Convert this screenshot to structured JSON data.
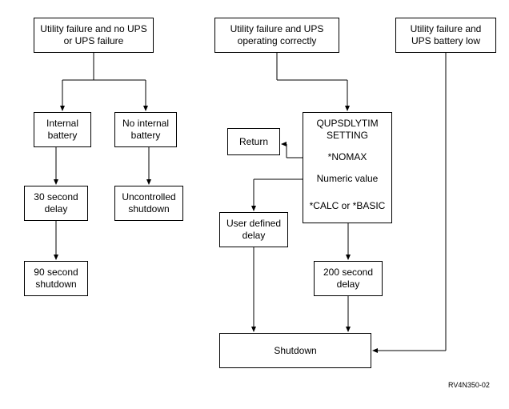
{
  "chart_data": {
    "type": "flowchart",
    "nodes": [
      {
        "id": "a1",
        "label": "Utility failure and\nno UPS or UPS failure"
      },
      {
        "id": "a2",
        "label": "Internal\nbattery"
      },
      {
        "id": "a3",
        "label": "No internal\nbattery"
      },
      {
        "id": "a4",
        "label": "30 second\ndelay"
      },
      {
        "id": "a5",
        "label": "Uncontrolled\nshutdown"
      },
      {
        "id": "a6",
        "label": "90 second\nshutdown"
      },
      {
        "id": "b1",
        "label": "Utility failure and UPS\noperating correctly"
      },
      {
        "id": "b2",
        "label": "Return"
      },
      {
        "id": "b3a",
        "label": "QUPSDLYTIM\nSETTING"
      },
      {
        "id": "b3b",
        "label": "*NOMAX"
      },
      {
        "id": "b3c",
        "label": "Numeric value"
      },
      {
        "id": "b3d",
        "label": "*CALC or\n*BASIC"
      },
      {
        "id": "b4",
        "label": "User defined\ndelay"
      },
      {
        "id": "b5",
        "label": "200 second\ndelay"
      },
      {
        "id": "b6",
        "label": "Shutdown"
      },
      {
        "id": "c1",
        "label": "Utility failure and\nUPS battery low"
      }
    ],
    "edges": [
      {
        "from": "a1",
        "to": "a2"
      },
      {
        "from": "a1",
        "to": "a3"
      },
      {
        "from": "a2",
        "to": "a4"
      },
      {
        "from": "a3",
        "to": "a5"
      },
      {
        "from": "a4",
        "to": "a6"
      },
      {
        "from": "b1",
        "to": "b3a"
      },
      {
        "from": "b3b",
        "to": "b2"
      },
      {
        "from": "b3c",
        "to": "b4"
      },
      {
        "from": "b3d",
        "to": "b5"
      },
      {
        "from": "b4",
        "to": "b6"
      },
      {
        "from": "b5",
        "to": "b6"
      },
      {
        "from": "c1",
        "to": "b6"
      }
    ],
    "footer": "RV4N350-02"
  },
  "boxes": {
    "a1": "Utility failure and no UPS or UPS failure",
    "a2": "Internal battery",
    "a3": "No internal battery",
    "a4": "30 second delay",
    "a5": "Uncontrolled shutdown",
    "a6": "90 second shutdown",
    "b1": "Utility failure and UPS operating correctly",
    "b2": "Return",
    "b3a": "QUPSDLYTIM SETTING",
    "b3b": "*NOMAX",
    "b3c": "Numeric value",
    "b3d": "*CALC or *BASIC",
    "b4": "User defined delay",
    "b5": "200 second delay",
    "b6": "Shutdown",
    "c1": "Utility failure and UPS battery low"
  },
  "footer": "RV4N350-02"
}
